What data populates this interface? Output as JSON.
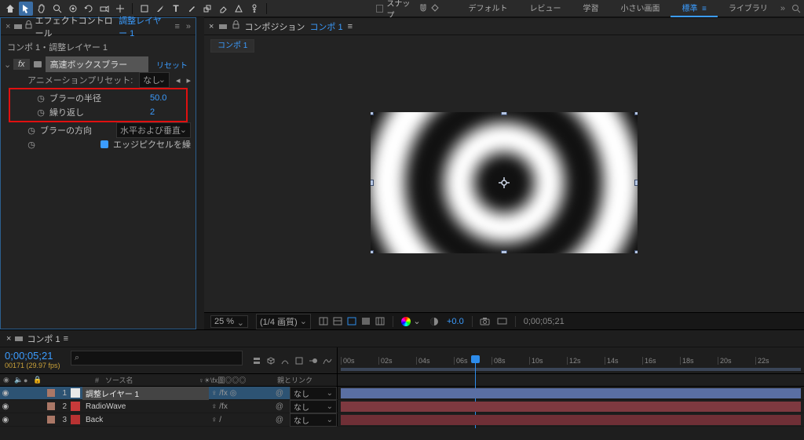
{
  "toolbar": {
    "snap_label": "スナップ",
    "workspaces": [
      "デフォルト",
      "レビュー",
      "学習",
      "小さい画面",
      "標準",
      "ライブラリ"
    ],
    "ws_active_index": 4
  },
  "effect_controls": {
    "tab_label": "エフェクトコントロール",
    "layer_name": "調整レイヤー 1",
    "breadcrumb": "コンポ 1・調整レイヤー 1",
    "fx_name": "高速ボックスブラー",
    "reset": "リセット",
    "preset_label": "アニメーションプリセット:",
    "preset_value": "なし",
    "props": {
      "radius_label": "ブラーの半径",
      "radius_value": "50.0",
      "iterations_label": "繰り返し",
      "iterations_value": "2",
      "dir_label": "ブラーの方向",
      "dir_value": "水平および垂直",
      "edge_label": "エッジピクセルを繰"
    }
  },
  "comp_panel": {
    "tab_label": "コンポジション",
    "comp_name": "コンポ 1",
    "flow": "コンポ 1"
  },
  "viewer_bar": {
    "zoom": "25 %",
    "res": "(1/4 画質)",
    "exposure": "+0.0",
    "timecode": "0;00;05;21"
  },
  "timeline": {
    "tab_label": "コンポ 1",
    "timecode": "0;00;05;21",
    "frames": "00171 (29.97 fps)",
    "search_placeholder": "",
    "col_idx": "#",
    "col_name": "ソース名",
    "col_switch": "♀☀\\fx圖◎◎◎",
    "col_parent": "親とリンク",
    "none": "なし",
    "ticks": [
      "00s",
      "02s",
      "04s",
      "06s",
      "08s",
      "10s",
      "12s",
      "14s",
      "16s",
      "18s",
      "20s",
      "22s"
    ],
    "layers": [
      {
        "idx": "1",
        "name": "調整レイヤー 1",
        "sw": "♀  /fx   ◎",
        "color": "white",
        "bar": "adj",
        "sel": true
      },
      {
        "idx": "2",
        "name": "RadioWave",
        "sw": "♀  /fx",
        "color": "red",
        "bar": "red",
        "sel": false
      },
      {
        "idx": "3",
        "name": "Back",
        "sw": "♀  /",
        "color": "red2",
        "bar": "red2",
        "sel": false
      }
    ]
  }
}
